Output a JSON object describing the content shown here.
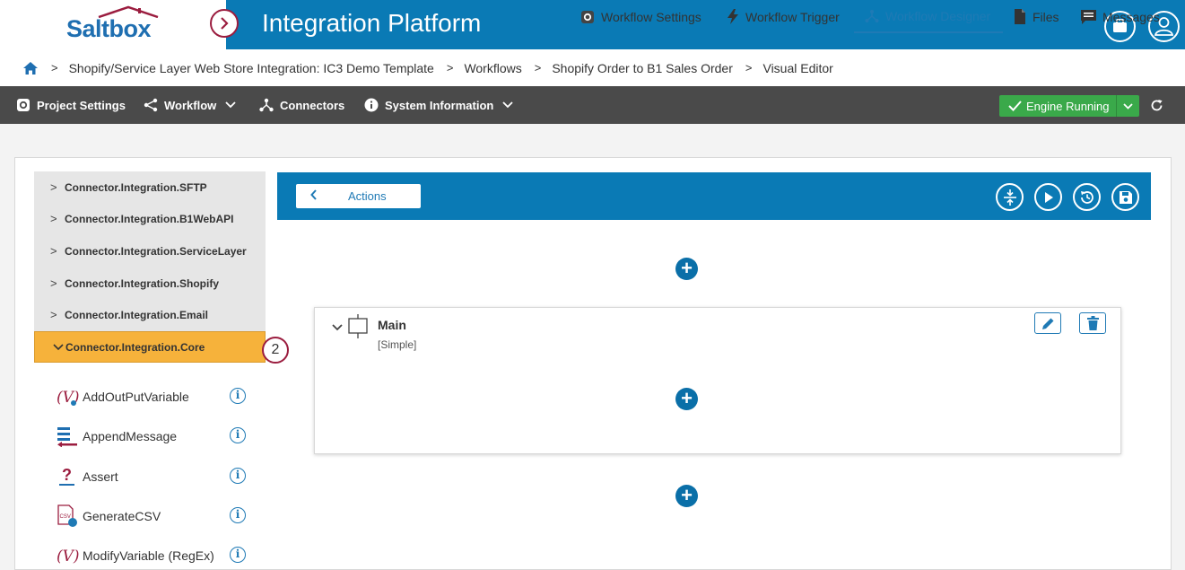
{
  "header": {
    "logo_text": "Saltbox",
    "app_title": "Integration Platform"
  },
  "breadcrumb": [
    "Shopify/Service Layer Web Store Integration: IC3 Demo Template",
    "Workflows",
    "Shopify Order to B1 Sales Order",
    "Visual Editor"
  ],
  "toolbar": {
    "project_settings": "Project Settings",
    "workflow": "Workflow",
    "connectors": "Connectors",
    "system_information": "System Information",
    "engine_status": "Engine Running"
  },
  "tabs": {
    "workflow_settings": "Workflow Settings",
    "workflow_trigger": "Workflow Trigger",
    "workflow_designer": "Workflow Designer",
    "files": "Files",
    "messages": "Messages"
  },
  "connectors": [
    "Connector.Integration.SFTP",
    "Connector.Integration.B1WebAPI",
    "Connector.Integration.ServiceLayer",
    "Connector.Integration.Shopify",
    "Connector.Integration.Email",
    "Connector.Integration.Core"
  ],
  "active_connector_badge": "2",
  "actions_list": [
    "AddOutPutVariable",
    "AppendMessage",
    "Assert",
    "GenerateCSV",
    "ModifyVariable (RegEx)"
  ],
  "designer": {
    "actions_button": "Actions",
    "main_title": "Main",
    "main_subtitle": "[Simple]"
  },
  "colors": {
    "header_blue": "#0a7ab5",
    "accent_maroon": "#9b1d3f",
    "active_orange": "#f6b23b",
    "engine_green": "#3aa94a"
  }
}
